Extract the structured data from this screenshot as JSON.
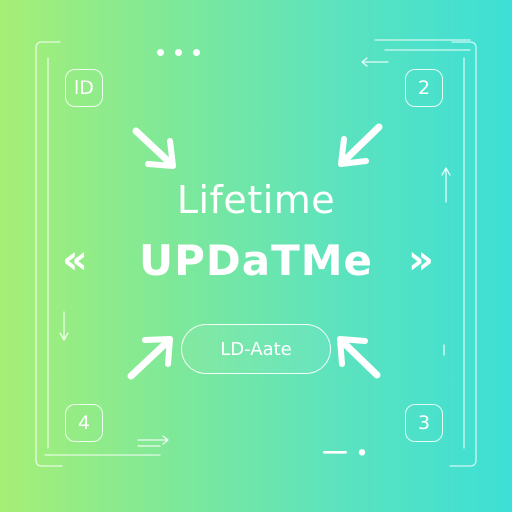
{
  "headline": {
    "line1": "Lifetime",
    "line2": "UPDaTMe"
  },
  "pill_button": {
    "label": "LD-Aate"
  },
  "corner_badges": {
    "top_left": "lD",
    "top_right": "2",
    "bottom_left": "4",
    "bottom_right": "3"
  },
  "chevrons": {
    "left": "«",
    "right": "»"
  },
  "colors": {
    "gradient_start": "#a6ef76",
    "gradient_end": "#3ddfd6",
    "foreground": "#ffffff"
  },
  "icons": [
    "arrow-down-right-icon",
    "arrow-down-left-icon",
    "arrow-up-right-icon",
    "arrow-up-left-icon",
    "double-chevron-left-icon",
    "double-chevron-right-icon",
    "arrow-left-icon",
    "arrow-right-icon",
    "arrow-up-icon",
    "arrow-down-icon",
    "three-dots-icon"
  ]
}
